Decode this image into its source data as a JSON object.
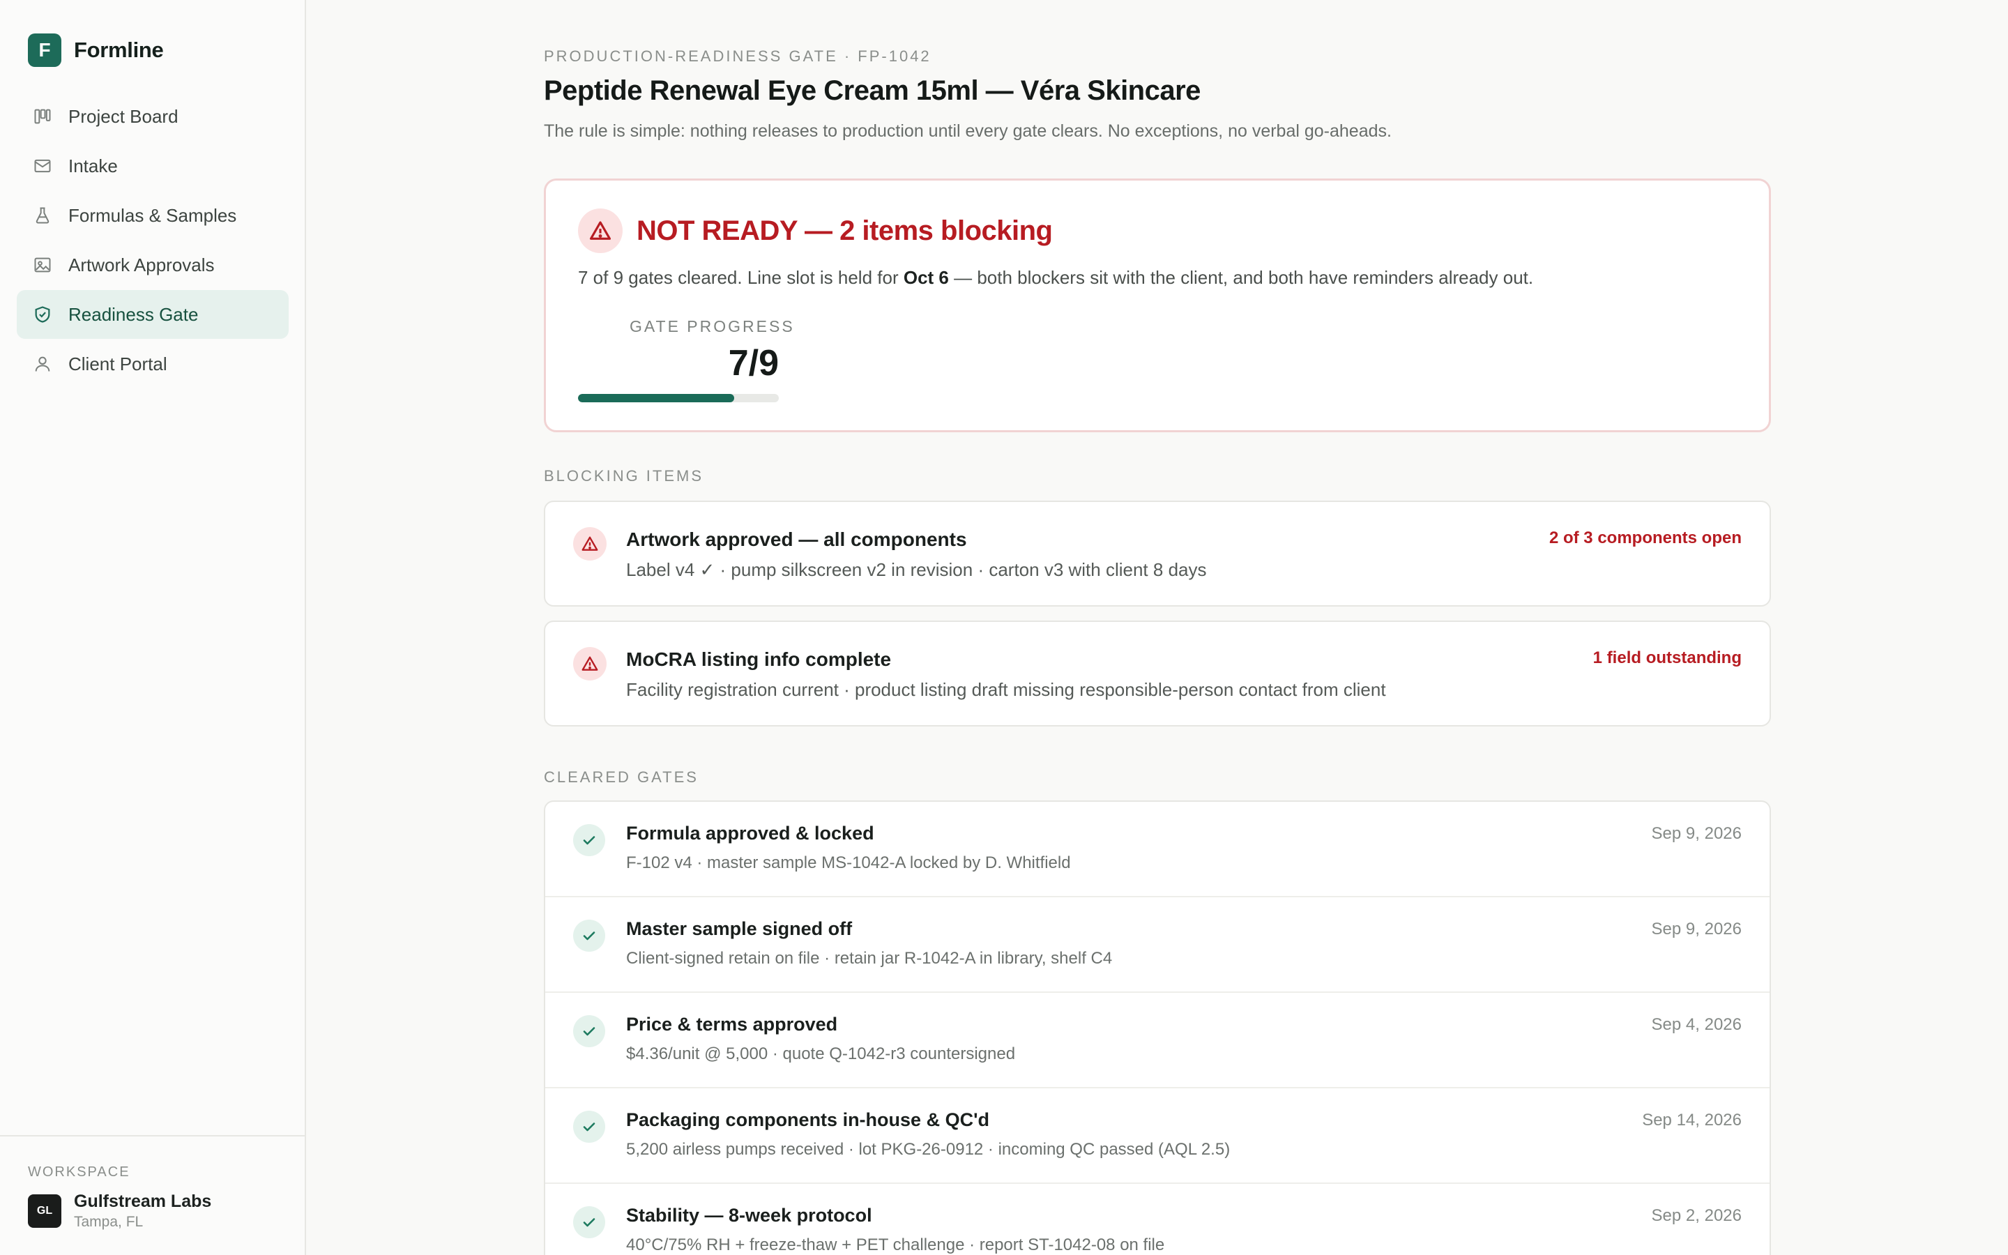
{
  "app": {
    "name": "Formline",
    "logo_letter": "F"
  },
  "sidebar": {
    "items": [
      {
        "label": "Project Board",
        "icon": "board-icon",
        "active": false
      },
      {
        "label": "Intake",
        "icon": "mail-icon",
        "active": false
      },
      {
        "label": "Formulas & Samples",
        "icon": "flask-icon",
        "active": false
      },
      {
        "label": "Artwork Approvals",
        "icon": "image-icon",
        "active": false
      },
      {
        "label": "Readiness Gate",
        "icon": "shield-check-icon",
        "active": true
      },
      {
        "label": "Client Portal",
        "icon": "user-icon",
        "active": false
      }
    ],
    "workspace": {
      "label": "WORKSPACE",
      "initials": "GL",
      "name": "Gulfstream Labs",
      "location": "Tampa, FL"
    }
  },
  "page": {
    "eyebrow": "PRODUCTION-READINESS GATE · FP-1042",
    "title": "Peptide Renewal Eye Cream 15ml — Véra Skincare",
    "subtitle": "The rule is simple: nothing releases to production until every gate clears. No exceptions, no verbal go-aheads."
  },
  "status": {
    "title": "NOT READY — 2 items blocking",
    "desc_before": "7 of 9 gates cleared. Line slot is held for ",
    "desc_bold": "Oct 6",
    "desc_after": " — both blockers sit with the client, and both have reminders already out.",
    "progress_label": "GATE PROGRESS",
    "progress_value": "7/9",
    "progress_fraction": 0.7778,
    "colors": {
      "danger": "#b71c22",
      "accent": "#1a6b58"
    }
  },
  "blocking": {
    "section_label": "BLOCKING ITEMS",
    "items": [
      {
        "title": "Artwork approved — all components",
        "detail": "Label v4 ✓ · pump silkscreen v2 in revision · carton v3 with client 8 days",
        "flag": "2 of 3 components open"
      },
      {
        "title": "MoCRA listing info complete",
        "detail": "Facility registration current · product listing draft missing responsible-person contact from client",
        "flag": "1 field outstanding"
      }
    ]
  },
  "cleared": {
    "section_label": "CLEARED GATES",
    "items": [
      {
        "title": "Formula approved & locked",
        "detail": "F-102 v4 · master sample MS-1042-A locked by D. Whitfield",
        "date": "Sep 9, 2026"
      },
      {
        "title": "Master sample signed off",
        "detail": "Client-signed retain on file · retain jar R-1042-A in library, shelf C4",
        "date": "Sep 9, 2026"
      },
      {
        "title": "Price & terms approved",
        "detail": "$4.36/unit @ 5,000 · quote Q-1042-r3 countersigned",
        "date": "Sep 4, 2026"
      },
      {
        "title": "Packaging components in-house & QC'd",
        "detail": "5,200 airless pumps received · lot PKG-26-0912 · incoming QC passed (AQL 2.5)",
        "date": "Sep 14, 2026"
      },
      {
        "title": "Stability — 8-week protocol",
        "detail": "40°C/75% RH + freeze-thaw + PET challenge · report ST-1042-08 on file",
        "date": "Sep 2, 2026"
      }
    ]
  }
}
